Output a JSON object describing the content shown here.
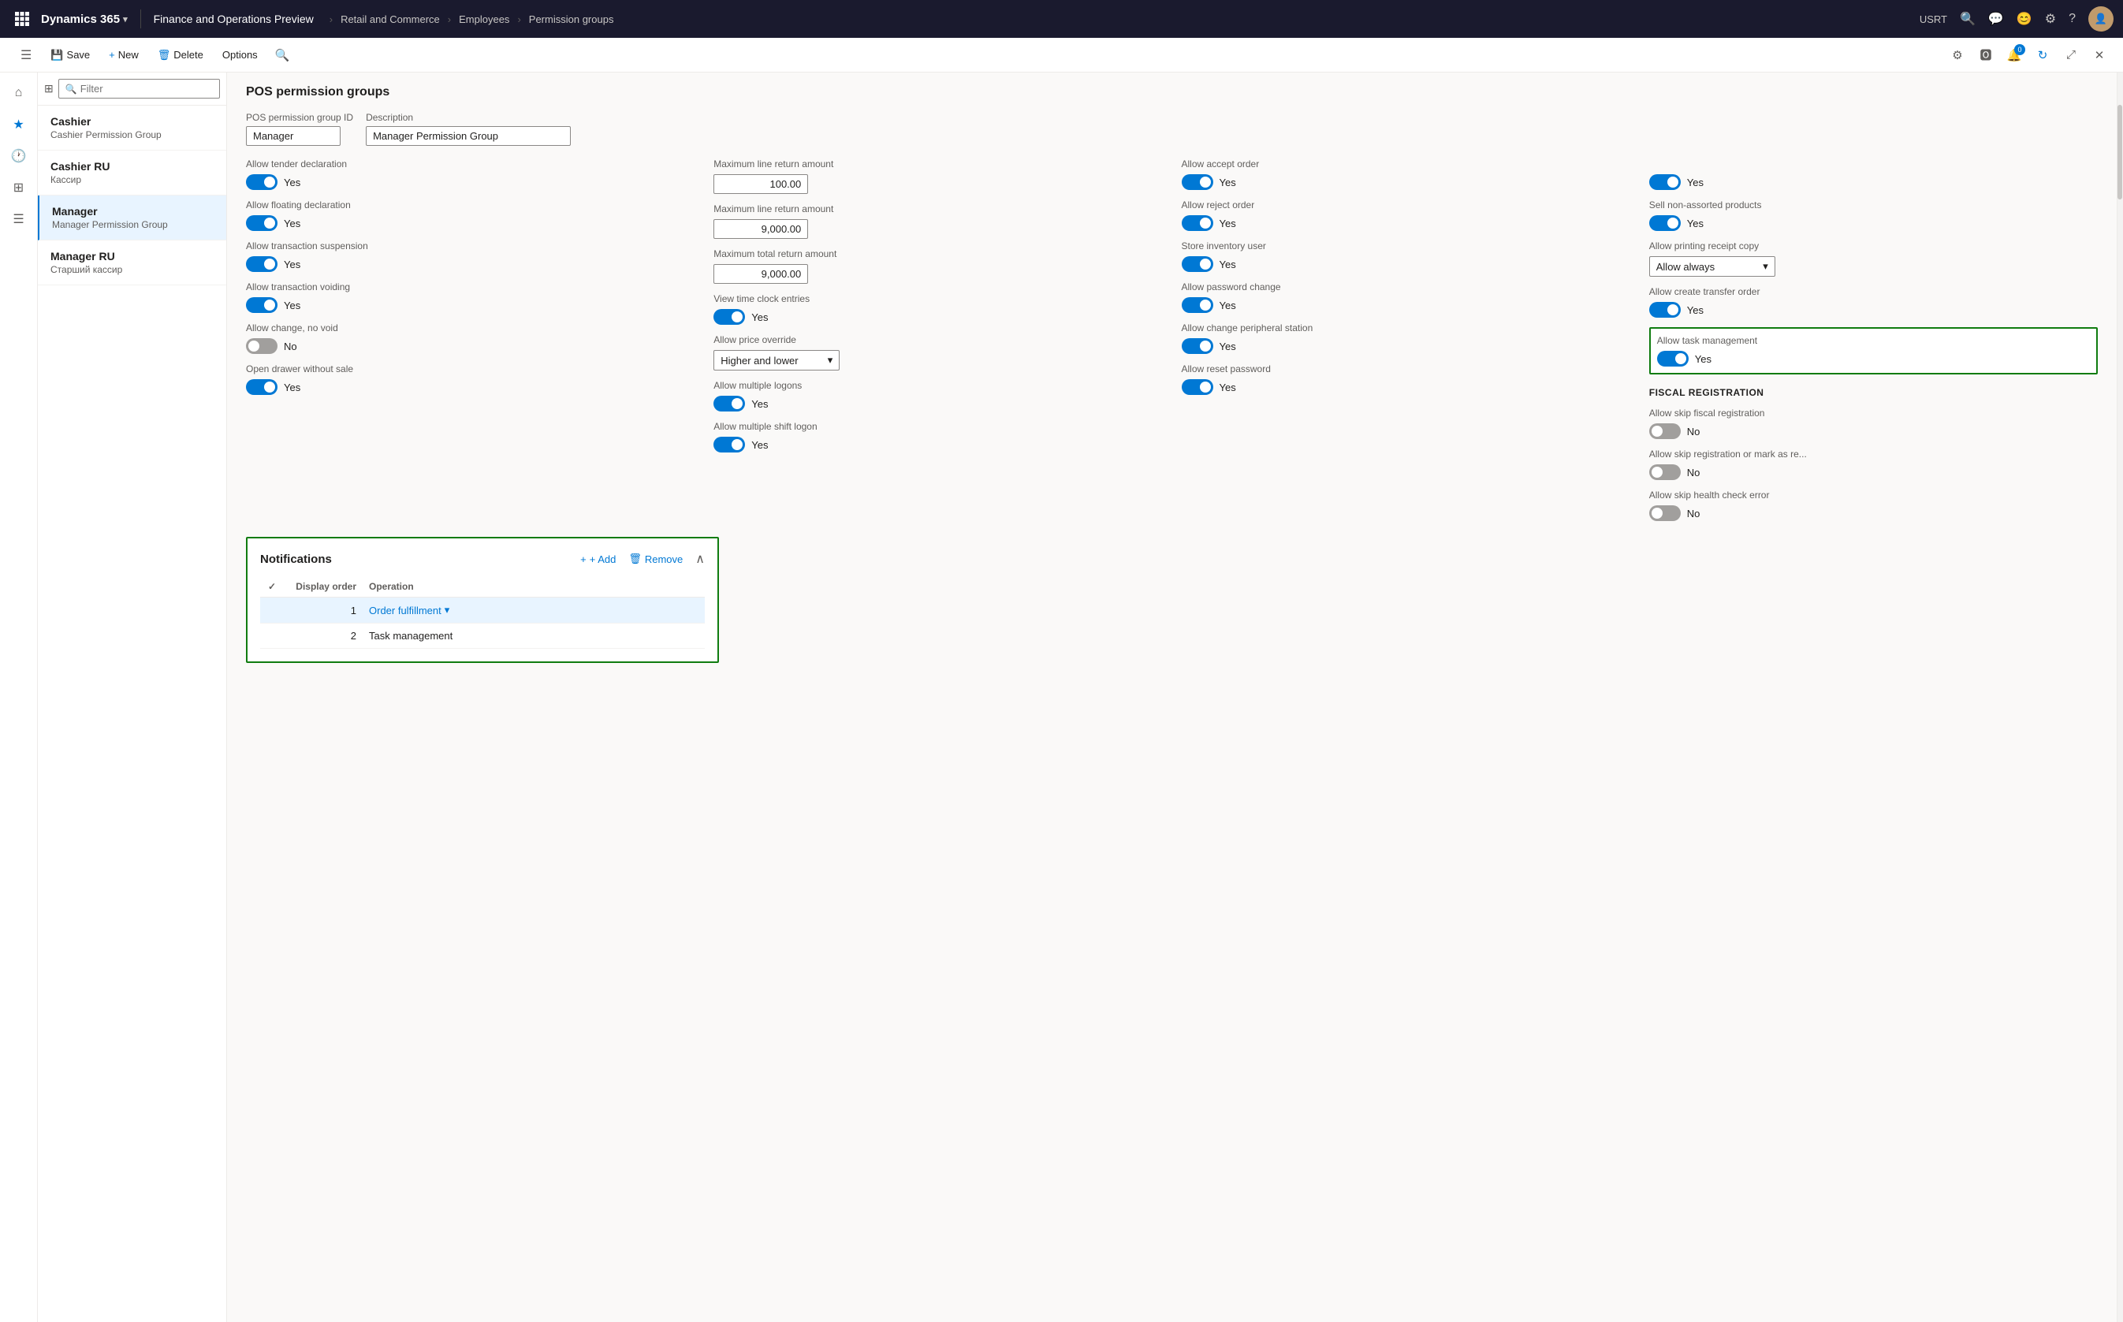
{
  "topNav": {
    "waffle": "⊞",
    "appName": "Dynamics 365",
    "chevron": "∨",
    "product": "Finance and Operations Preview",
    "breadcrumbs": [
      "Retail and Commerce",
      "Employees",
      "Permission groups"
    ],
    "userTag": "USRT"
  },
  "commandBar": {
    "save": "Save",
    "new": "New",
    "delete": "Delete",
    "options": "Options"
  },
  "sidebar": {
    "icons": [
      "☰",
      "⌂",
      "★",
      "🕐",
      "⊞",
      "☰"
    ]
  },
  "listPanel": {
    "searchPlaceholder": "Filter",
    "items": [
      {
        "title": "Cashier",
        "subtitle": "Cashier Permission Group",
        "selected": false
      },
      {
        "title": "Cashier RU",
        "subtitle": "Кассир",
        "selected": false
      },
      {
        "title": "Manager",
        "subtitle": "Manager Permission Group",
        "selected": true
      },
      {
        "title": "Manager RU",
        "subtitle": "Старший кассир",
        "selected": false
      }
    ]
  },
  "detailPanel": {
    "sectionHeader": "POS permission groups",
    "idLabel": "POS permission group ID",
    "descLabel": "Description",
    "idValue": "Manager",
    "descValue": "Manager Permission Group",
    "properties": {
      "col1": [
        {
          "label": "Allow tender declaration",
          "toggle": "on",
          "value": "Yes"
        },
        {
          "label": "Allow floating declaration",
          "toggle": "on",
          "value": "Yes"
        },
        {
          "label": "Allow transaction suspension",
          "toggle": "on",
          "value": "Yes"
        },
        {
          "label": "Allow transaction voiding",
          "toggle": "on",
          "value": "Yes"
        },
        {
          "label": "Allow change, no void",
          "toggle": "off",
          "value": "No"
        },
        {
          "label": "Open drawer without sale",
          "toggle": "on",
          "value": "Yes"
        }
      ],
      "col2": [
        {
          "label": "Maximum line return amount",
          "inputValue": "100.00",
          "type": "input"
        },
        {
          "label": "Maximum line return amount",
          "inputValue": "9,000.00",
          "type": "input"
        },
        {
          "label": "Maximum total return amount",
          "inputValue": "9,000.00",
          "type": "input"
        },
        {
          "label": "View time clock entries",
          "toggle": "on",
          "value": "Yes"
        },
        {
          "label": "Allow price override",
          "dropdownValue": "Higher and lower",
          "type": "dropdown"
        },
        {
          "label": "Allow multiple logons",
          "toggle": "on",
          "value": "Yes"
        },
        {
          "label": "Allow multiple shift logon",
          "toggle": "on",
          "value": "Yes"
        }
      ],
      "col3": [
        {
          "label": "Allow accept order",
          "toggle": "on",
          "value": "Yes"
        },
        {
          "label": "Allow reject order",
          "toggle": "on",
          "value": "Yes"
        },
        {
          "label": "Store inventory user",
          "toggle": "on",
          "value": "Yes"
        },
        {
          "label": "Allow password change",
          "toggle": "on",
          "value": "Yes"
        },
        {
          "label": "Allow change peripheral station",
          "toggle": "on",
          "value": "Yes"
        },
        {
          "label": "Allow reset password",
          "toggle": "on",
          "value": "Yes"
        }
      ],
      "col4": [
        {
          "label": "",
          "toggle": "on",
          "value": "Yes"
        },
        {
          "label": "Sell non-assorted products",
          "toggle": "on",
          "value": "Yes"
        },
        {
          "label": "Allow printing receipt copy",
          "dropdownValue": "Allow always",
          "type": "dropdown"
        },
        {
          "label": "Allow create transfer order",
          "toggle": "on",
          "value": "Yes"
        },
        {
          "label": "Allow task management",
          "toggle": "on",
          "value": "Yes",
          "highlighted": true
        }
      ]
    },
    "fiscalRegistration": {
      "title": "FISCAL REGISTRATION",
      "items": [
        {
          "label": "Allow skip fiscal registration",
          "toggle": "off",
          "value": "No"
        },
        {
          "label": "Allow skip registration or mark as re...",
          "toggle": "off",
          "value": "No"
        },
        {
          "label": "Allow skip health check error",
          "toggle": "off",
          "value": "No"
        }
      ]
    },
    "notifications": {
      "title": "Notifications",
      "addLabel": "+ Add",
      "removeLabel": "Remove",
      "tableHeaders": [
        "",
        "Display order",
        "Operation"
      ],
      "rows": [
        {
          "selected": true,
          "order": "1",
          "operation": "Order fulfillment",
          "isLink": true
        },
        {
          "selected": false,
          "order": "2",
          "operation": "Task management",
          "isLink": false
        }
      ]
    }
  }
}
